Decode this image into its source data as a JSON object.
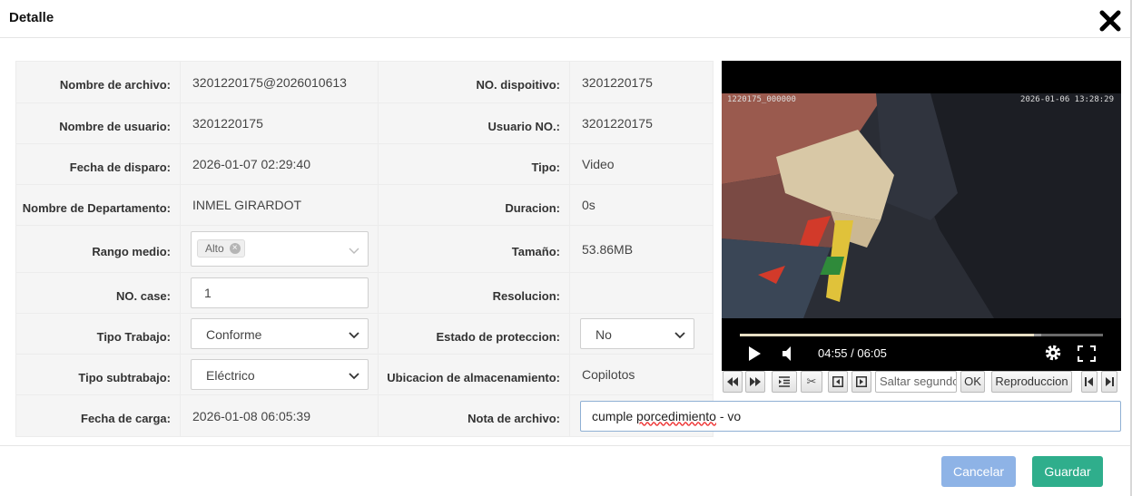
{
  "dialog": {
    "title": "Detalle"
  },
  "rows": [
    {
      "l1": "Nombre de archivo:",
      "v1": "3201220175@2026010613",
      "l2": "NO. dispoitivo:",
      "v2": "3201220175"
    },
    {
      "l1": "Nombre de usuario:",
      "v1": "3201220175",
      "l2": "Usuario NO.:",
      "v2": "3201220175"
    },
    {
      "l1": "Fecha de disparo:",
      "v1": "2026-01-07 02:29:40",
      "l2": "Tipo:",
      "v2": "Video"
    },
    {
      "l1": "Nombre de Departamento:",
      "v1": "INMEL GIRARDOT",
      "l2": "Duracion:",
      "v2": "0s"
    },
    {
      "l1": "Rango medio:",
      "v1": "Alto",
      "l2": "Tamaño:",
      "v2": "53.86MB"
    },
    {
      "l1": "NO. case:",
      "v1": "1",
      "l2": "Resolucion:",
      "v2": ""
    },
    {
      "l1": "Tipo Trabajo:",
      "v1": "Conforme",
      "l2": "Estado de proteccion:",
      "v2": "No"
    },
    {
      "l1": "Tipo subtrabajo:",
      "v1": "Eléctrico",
      "l2": "Ubicacion de almacenamiento:",
      "v2": "Copilotos"
    },
    {
      "l1": "Fecha de carga:",
      "v1": "2026-01-08 06:05:39",
      "l2": "Nota de archivo:",
      "v2a": "cumple ",
      "v2b": "porcedimiento",
      "v2c": " - vo"
    }
  ],
  "video": {
    "osd_left": "1220175_000000",
    "osd_right": "2026-01-06  13:28:29",
    "time": "04:55 / 06:05",
    "progress": 0.81,
    "buffered": 0.83
  },
  "toolbar": {
    "seek_placeholder": "Saltar segundo",
    "ok_label": "OK",
    "play_label": "Reproduccion"
  },
  "footer": {
    "cancel_label": "Cancelar",
    "save_label": "Guardar"
  },
  "colors": {
    "cancel": "#8eb3e6",
    "save": "#2fae8c",
    "note_border": "#8fb0d4"
  }
}
